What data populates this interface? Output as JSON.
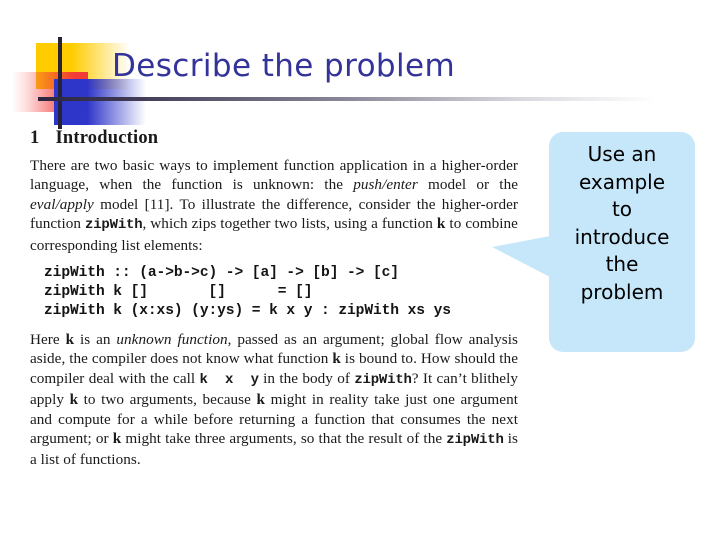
{
  "slide": {
    "title": "Describe the problem",
    "title_color": "#333399",
    "background": "#ffffff"
  },
  "decoration": {
    "yellow_swatch_color": "#FFCC00",
    "red_swatch_color": "#F23A37",
    "blue_swatch_color": "#2E35C9",
    "bar_color": "#262338",
    "rule_color": "#2b2740"
  },
  "paper": {
    "section_number": "1",
    "section_title": "Introduction",
    "paragraph_1": {
      "runs": [
        {
          "text": "There are two basic ways to implement function application in a higher-order language, when the function is unknown: the ",
          "style": "roman"
        },
        {
          "text": "push/enter",
          "style": "italic"
        },
        {
          "text": " model or the ",
          "style": "roman"
        },
        {
          "text": "eval/apply",
          "style": "italic"
        },
        {
          "text": " model [11]. To illustrate the difference, consider the higher-order function ",
          "style": "roman"
        },
        {
          "text": "zipWith",
          "style": "mono-bold"
        },
        {
          "text": ", which zips together two lists, using a function ",
          "style": "roman"
        },
        {
          "text": "k",
          "style": "bold"
        },
        {
          "text": " to combine corresponding list elements:",
          "style": "roman"
        }
      ],
      "plain": "There are two basic ways to implement function application in a higher-order language, when the function is unknown: the push/enter model or the eval/apply model [11]. To illustrate the difference, consider the higher-order function zipWith, which zips together two lists, using a function k to combine corresponding list elements:"
    },
    "code_block": [
      "zipWith :: (a->b->c) -> [a] -> [b] -> [c]",
      "zipWith k []       []      = []",
      "zipWith k (x:xs) (y:ys) = k x y : zipWith xs ys"
    ],
    "paragraph_2": {
      "runs": [
        {
          "text": "Here ",
          "style": "roman"
        },
        {
          "text": "k",
          "style": "bold"
        },
        {
          "text": " is an ",
          "style": "roman"
        },
        {
          "text": "unknown function",
          "style": "italic"
        },
        {
          "text": ", passed as an argument; global flow analysis aside, the compiler does not know what function ",
          "style": "roman"
        },
        {
          "text": "k",
          "style": "bold"
        },
        {
          "text": " is bound to. How should the compiler deal with the call ",
          "style": "roman"
        },
        {
          "text": "k x y",
          "style": "mono-bold"
        },
        {
          "text": " in the body of ",
          "style": "roman"
        },
        {
          "text": "zipWith",
          "style": "mono-bold"
        },
        {
          "text": "? It can't blithely apply ",
          "style": "roman"
        },
        {
          "text": "k",
          "style": "bold"
        },
        {
          "text": " to two arguments, because ",
          "style": "roman"
        },
        {
          "text": "k",
          "style": "bold"
        },
        {
          "text": " might in reality take just one argument and compute for a while before returning a function that consumes the next argument; or ",
          "style": "roman"
        },
        {
          "text": "k",
          "style": "bold"
        },
        {
          "text": " might take three arguments, so that the result of the ",
          "style": "roman"
        },
        {
          "text": "zipWith",
          "style": "mono-bold"
        },
        {
          "text": " is a list of functions.",
          "style": "roman"
        }
      ],
      "plain": "Here k is an unknown function, passed as an argument; global flow analysis aside, the compiler does not know what function k is bound to. How should the compiler deal with the call k x y in the body of zipWith? It can't blithely apply k to two arguments, because k might in reality take just one argument and compute for a while before returning a function that consumes the next argument; or k might take three arguments, so that the result of the zipWith is a list of functions."
    }
  },
  "callout": {
    "fill_color": "#C5E7F9",
    "text_color": "#000000",
    "lines": [
      "Use an",
      "example",
      "to",
      "introduce",
      "the",
      "problem"
    ],
    "full_text": "Use an example to introduce the problem"
  }
}
